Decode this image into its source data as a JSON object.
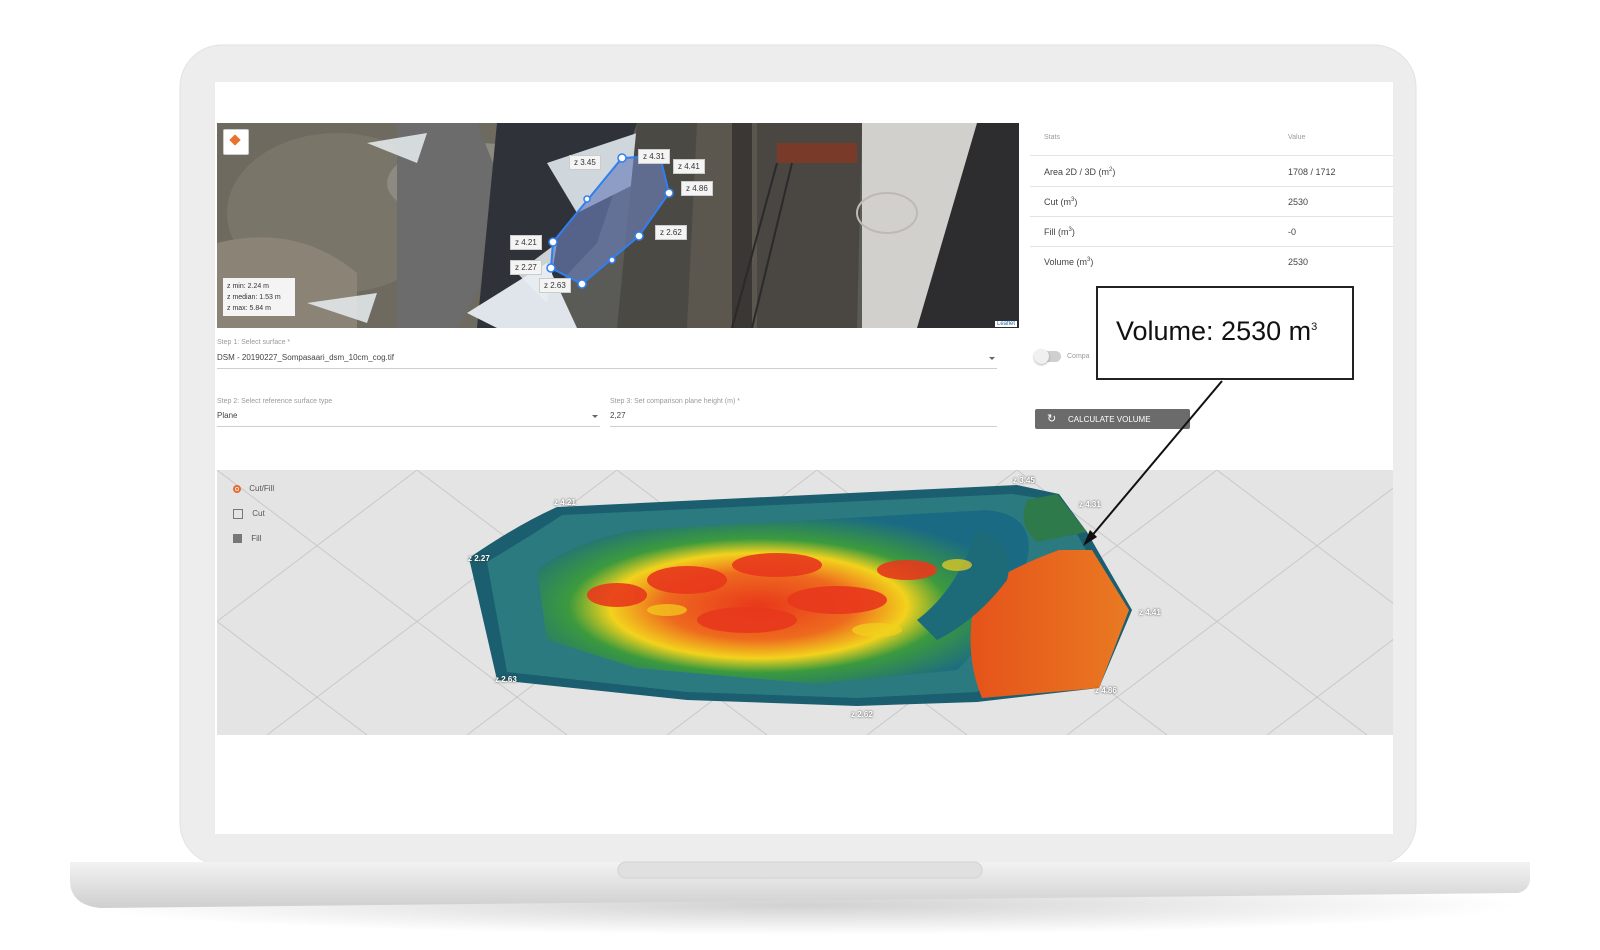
{
  "map": {
    "z_labels": [
      "z 3.45",
      "z 4.31",
      "z 4.41",
      "z 4.86",
      "z 2.62",
      "z 4.21",
      "z 2.27",
      "z 2.63"
    ],
    "zstats": {
      "min": "z min: 2.24 m",
      "median": "z median: 1.53 m",
      "max": "z max: 5.84 m"
    },
    "attribution": "Leaflet"
  },
  "stats": {
    "header_key": "Stats",
    "header_value": "Value",
    "rows": [
      {
        "key": "Area 2D / 3D (m",
        "sup": "2",
        "close": ")",
        "value": "1708 / 1712"
      },
      {
        "key": "Cut (m",
        "sup": "3",
        "close": ")",
        "value": "2530"
      },
      {
        "key": "Fill (m",
        "sup": "3",
        "close": ")",
        "value": "-0"
      },
      {
        "key": "Volume (m",
        "sup": "3",
        "close": ")",
        "value": "2530"
      }
    ]
  },
  "form": {
    "step1_label": "Step 1: Select surface *",
    "step1_value": "DSM - 20190227_Sompasaari_dsm_10cm_cog.tif",
    "toggle_label": "Compa",
    "step2_label": "Step 2: Select reference surface type",
    "step2_value": "Plane",
    "step3_label": "Step 3: Set comparison plane height (m) *",
    "step3_value": "2,27",
    "calc_button": "CALCULATE VOLUME"
  },
  "legend3d": {
    "items": [
      "Cut/Fill",
      "Cut",
      "Fill"
    ]
  },
  "view3d_labels": [
    "z 3.45",
    "z 4.31",
    "z 4.21",
    "z 2.27",
    "z 4.41",
    "z 2.63",
    "z 4.86",
    "z 2.62"
  ],
  "callout": {
    "text": "Volume: 2530 m",
    "sup": "3"
  },
  "colors": {
    "selection": "#2f7ff0",
    "cut_high": "#e8381c",
    "mid": "#f2d21d",
    "low": "#1a6a84",
    "button": "#6b6b6b",
    "legend_active": "#e96a2e"
  }
}
